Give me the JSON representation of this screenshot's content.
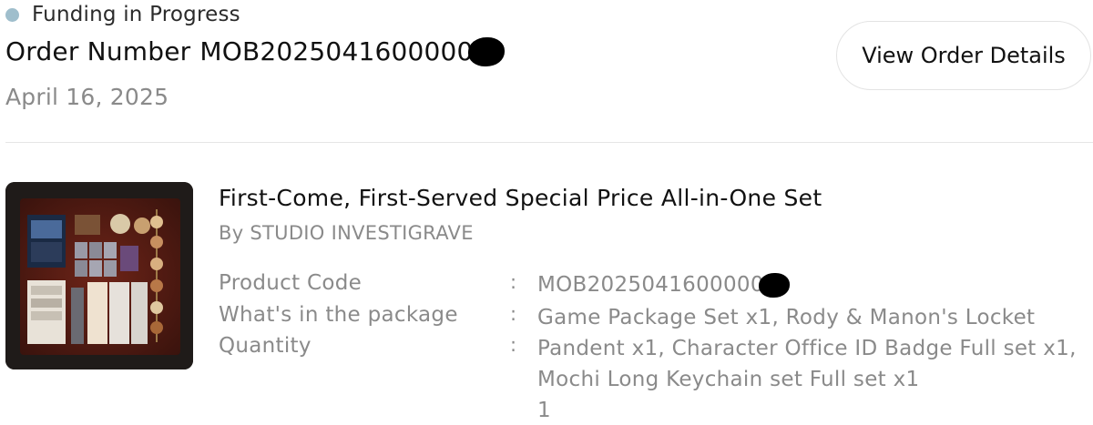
{
  "status": {
    "label": "Funding in Progress",
    "dot_color": "#9fbecc"
  },
  "order": {
    "number_label": "Order Number",
    "number_value": "MOB2025041600000",
    "date": "April 16, 2025",
    "view_button_label": "View Order Details"
  },
  "product": {
    "image_icon": "product-set-photo",
    "title": "First-Come, First-Served Special Price All-in-One Set",
    "by": "By STUDIO INVESTIGRAVE",
    "specs": {
      "code_label": "Product Code",
      "code_value": "MOB2025041600000",
      "package_label": "What's in the package",
      "package_value": "Game Package Set x1, Rody & Manon's Locket Pandent x1, Character Office ID Badge Full set x1, Mochi Long Keychain set Full set x1",
      "quantity_label": "Quantity",
      "quantity_value": "1",
      "separator": ":"
    }
  }
}
